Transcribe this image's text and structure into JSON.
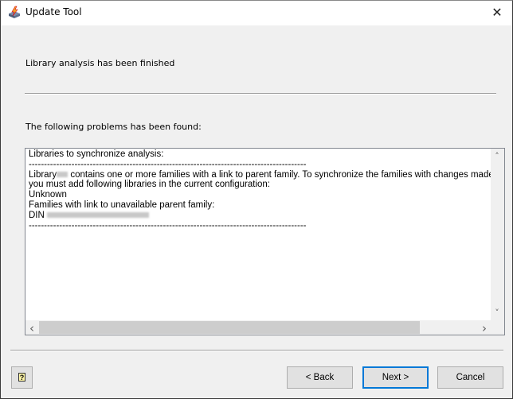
{
  "window": {
    "title": "Update Tool",
    "close_glyph": "✕"
  },
  "status_text": "Library analysis has been finished",
  "problems_label": "The following problems has been found:",
  "report": {
    "line1": "Libraries to synchronize analysis:",
    "divider": "-------------------------------------------------------------------------------------------",
    "line3_a": "Library",
    "line3_b": " contains one or more families with a link to parent family. To synchronize the families with changes made in the",
    "line4": "you must add following libraries in the current configuration:",
    "line5": "Unknown",
    "line6": "Families with link to unavailable parent family:",
    "line7": "DIN "
  },
  "scroll": {
    "left": "‹",
    "right": "›",
    "up": "˄",
    "down": "˅"
  },
  "buttons": {
    "help": "?",
    "back": "< Back",
    "next": "Next >",
    "cancel": "Cancel"
  }
}
